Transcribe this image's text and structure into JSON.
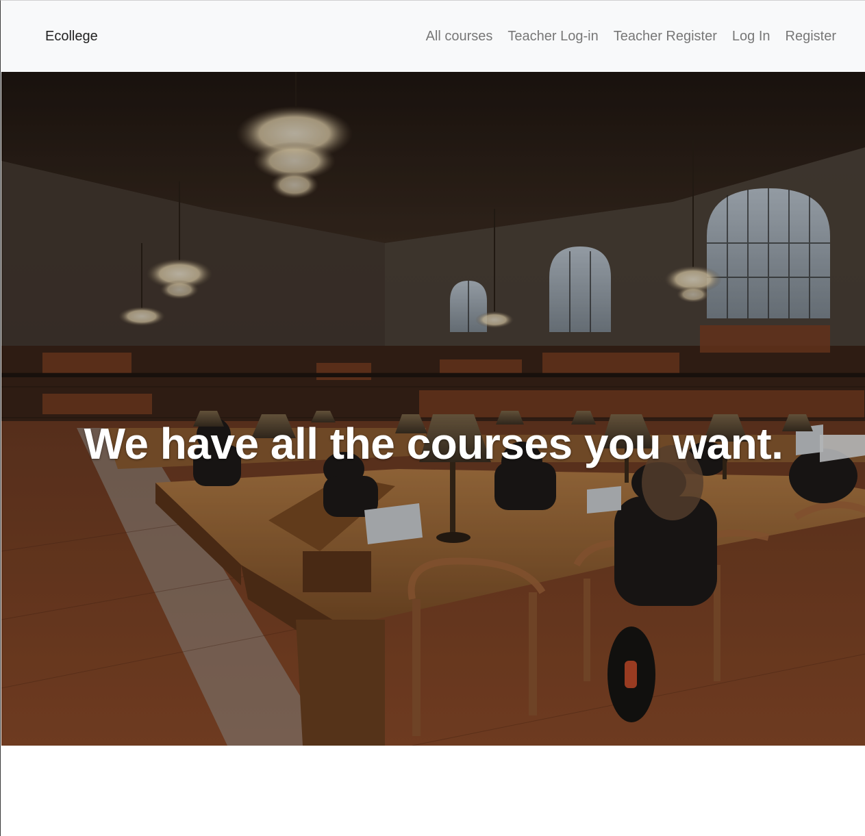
{
  "navbar": {
    "brand": "Ecollege",
    "links": [
      {
        "label": "All courses"
      },
      {
        "label": "Teacher Log-in"
      },
      {
        "label": "Teacher Register"
      },
      {
        "label": "Log In"
      },
      {
        "label": "Register"
      }
    ]
  },
  "hero": {
    "headline": "We have all the courses you want.",
    "image": "library-reading-room"
  },
  "colors": {
    "navbar_bg": "#f8f9fa",
    "brand_text": "#222222",
    "nav_link": "#777777",
    "hero_text": "#ffffff"
  }
}
